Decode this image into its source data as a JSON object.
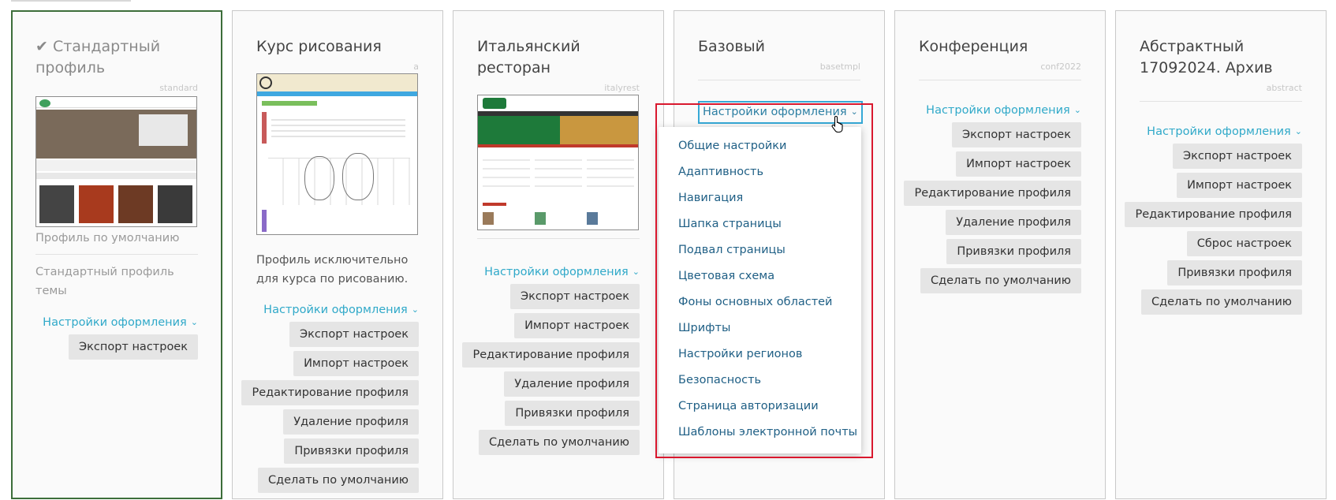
{
  "settings_label": "Настройки оформления",
  "dropdown_items": [
    "Общие настройки",
    "Адаптивность",
    "Навигация",
    "Шапка страницы",
    "Подвал страницы",
    "Цветовая схема",
    "Фоны основных областей",
    "Шрифты",
    "Настройки регионов",
    "Безопасность",
    "Страница авторизации",
    "Шаблоны электронной почты"
  ],
  "profiles": [
    {
      "title": "✔ Стандартный профиль",
      "code": "standard",
      "preview": "Профиль по умолчанию",
      "description": "Стандартный профиль темы",
      "actions": [
        "Экспорт настроек"
      ]
    },
    {
      "title": "Курс рисования",
      "code": "a",
      "description": "Профиль исключительно для курса по рисованию.",
      "actions": [
        "Экспорт настроек",
        "Импорт настроек",
        "Редактирование профиля",
        "Удаление профиля",
        "Привязки профиля",
        "Сделать по умолчанию"
      ]
    },
    {
      "title": "Итальянский ресторан",
      "code": "italyrest",
      "actions": [
        "Экспорт настроек",
        "Импорт настроек",
        "Редактирование профиля",
        "Удаление профиля",
        "Привязки профиля",
        "Сделать по умолчанию"
      ]
    },
    {
      "title": "Базовый",
      "code": "basetmpl"
    },
    {
      "title": "Конференция",
      "code": "conf2022",
      "actions": [
        "Экспорт настроек",
        "Импорт настроек",
        "Редактирование профиля",
        "Удаление профиля",
        "Привязки профиля",
        "Сделать по умолчанию"
      ]
    },
    {
      "title": "Абстрактный 17092024. Архив",
      "code": "abstract",
      "actions": [
        "Экспорт настроек",
        "Импорт настроек",
        "Редактирование профиля",
        "Сброс настроек",
        "Привязки профиля",
        "Сделать по умолчанию"
      ]
    }
  ],
  "colors": {
    "link": "#30a9c9",
    "active_border": "#3c6e3a",
    "highlight": "#d9182e",
    "button_bg": "#e5e5e5"
  }
}
